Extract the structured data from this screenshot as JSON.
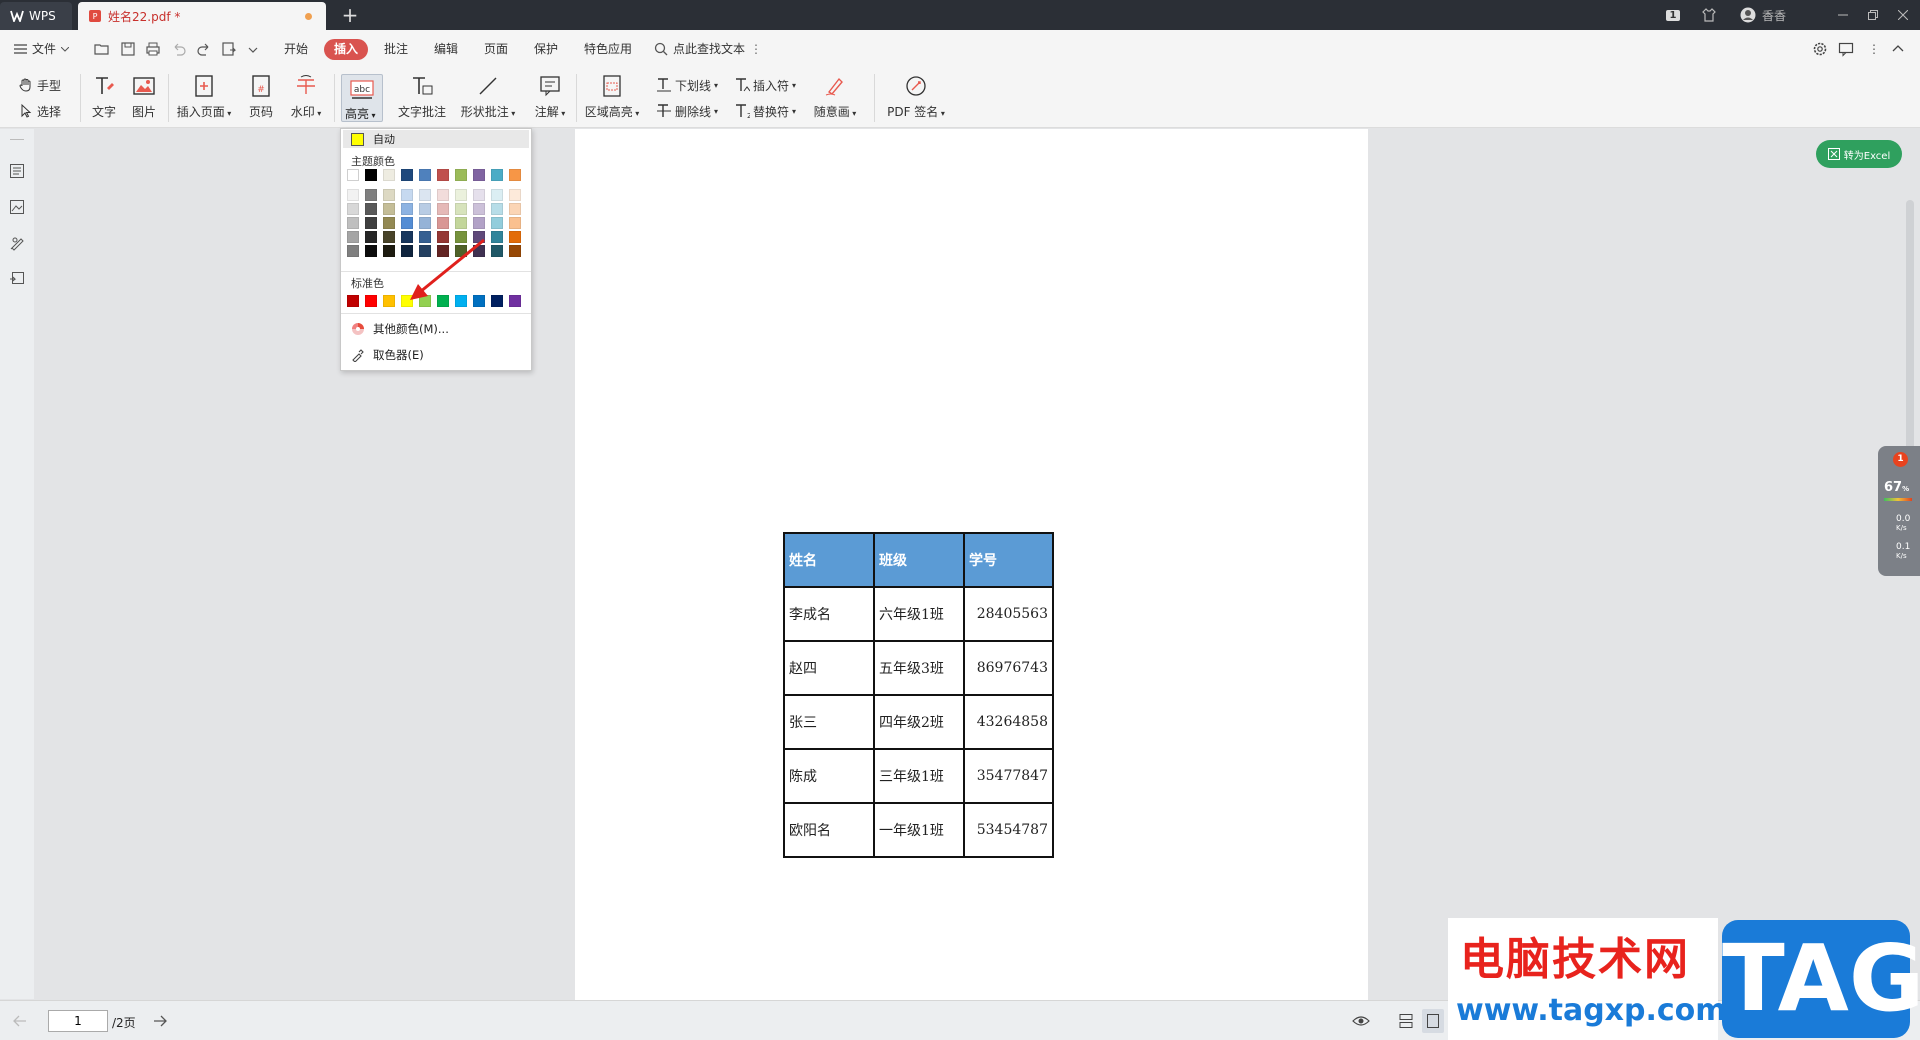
{
  "titlebar": {
    "app_tab": "WPS",
    "doc_tab": "姓名22.pdf *",
    "page_badge": "1",
    "user_name": "香香"
  },
  "menubar": {
    "file_label": "文件",
    "items": [
      "开始",
      "插入",
      "批注",
      "编辑",
      "页面",
      "保护",
      "特色应用"
    ],
    "active_item": "插入",
    "search_label": "点此查找文本"
  },
  "ribbon": {
    "hand": "手型",
    "select": "选择",
    "text": "文字",
    "image": "图片",
    "insert_page": "插入页面",
    "page_number": "页码",
    "watermark": "水印",
    "highlight": "高亮",
    "text_comment": "文字批注",
    "shape_comment": "形状批注",
    "note": "注解",
    "area_highlight": "区域高亮",
    "underline": "下划线",
    "strikethrough": "删除线",
    "insert_mark": "插入符",
    "replace_mark": "替换符",
    "freehand": "随意画",
    "pdf_sign": "PDF 签名"
  },
  "dropdown": {
    "auto": "自动",
    "theme_colors_label": "主题颜色",
    "standard_colors_label": "标准色",
    "more_colors": "其他颜色(M)...",
    "eyedropper": "取色器(E)",
    "theme_top_row": [
      "#ffffff",
      "#000000",
      "#eeece1",
      "#1f497d",
      "#4f81bd",
      "#c0504d",
      "#9bbb59",
      "#8064a2",
      "#4bacc6",
      "#f79646"
    ],
    "theme_shades": [
      [
        "#f2f2f2",
        "#7f7f7f",
        "#ddd9c3",
        "#c6d9f0",
        "#dbe5f1",
        "#f2dcdb",
        "#ebf1dd",
        "#e5e0ec",
        "#dbeef3",
        "#fdeada"
      ],
      [
        "#d8d8d8",
        "#595959",
        "#c4bd97",
        "#8db3e2",
        "#b8cce4",
        "#e5b9b7",
        "#d7e3bc",
        "#ccc1d9",
        "#b7dde8",
        "#fbd5b5"
      ],
      [
        "#bfbfbf",
        "#3f3f3f",
        "#938953",
        "#548dd4",
        "#95b3d7",
        "#d99694",
        "#c3d69b",
        "#b2a2c7",
        "#92cddc",
        "#fac08f"
      ],
      [
        "#a5a5a5",
        "#262626",
        "#494429",
        "#17365d",
        "#366092",
        "#953734",
        "#76923c",
        "#5f497a",
        "#31859b",
        "#e36c09"
      ],
      [
        "#7f7f7f",
        "#0c0c0c",
        "#1d1b10",
        "#0f243e",
        "#244061",
        "#632423",
        "#4f6128",
        "#3f3151",
        "#205867",
        "#974806"
      ]
    ],
    "standard_colors": [
      "#c00000",
      "#ff0000",
      "#ffc000",
      "#ffff00",
      "#92d050",
      "#00b050",
      "#00b0f0",
      "#0070c0",
      "#002060",
      "#7030a0"
    ]
  },
  "table": {
    "headers": [
      "姓名",
      "班级",
      "学号"
    ],
    "rows": [
      [
        "李成名",
        "六年级1班",
        "28405563"
      ],
      [
        "赵四",
        "五年级3班",
        "86976743"
      ],
      [
        "张三",
        "四年级2班",
        "43264858"
      ],
      [
        "陈成",
        "三年级1班",
        "35477847"
      ],
      [
        "欧阳名",
        "一年级1班",
        "53454787"
      ]
    ]
  },
  "floaters": {
    "excel_button": "转为Excel",
    "monitor_badge": "1",
    "monitor_percent": "67",
    "monitor_percent_unit": "%",
    "net_up": "0.0",
    "net_down": "0.1",
    "net_unit": "K/s"
  },
  "bottombar": {
    "page_input": "1",
    "page_total": "/2页"
  },
  "watermark": {
    "site_name": "电脑技术网",
    "url": "www.tagxp.com",
    "tag": "TAG"
  },
  "colors": {
    "accent": "#d9534f",
    "table_header": "#5b9bd5",
    "excel_green": "#2fa05e",
    "arrow_red": "#e0201c"
  }
}
